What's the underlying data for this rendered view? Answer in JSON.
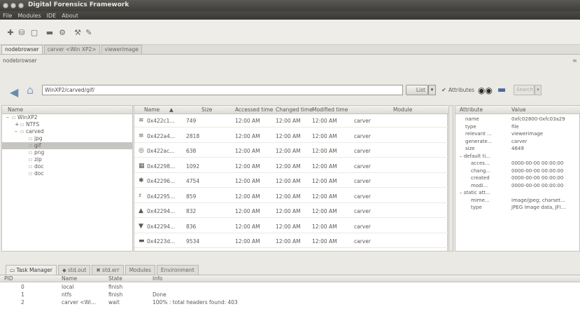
{
  "window": {
    "title": "Digital Forensics Framework"
  },
  "menu": [
    "File",
    "Modules",
    "IDE",
    "About"
  ],
  "tabs": [
    "nodebrowser",
    "carver <Win XP2>",
    "viewerimage"
  ],
  "pane_title": "nodebrowser",
  "pane_close": "≡",
  "path": "WinXP2/carved/gif/",
  "view_button": "List",
  "attributes_label": "Attributes",
  "search_button": "Search",
  "tree": {
    "header": "Name",
    "items": [
      {
        "label": "WinXP2",
        "level": 0,
        "expander": "–"
      },
      {
        "label": "NTFS",
        "level": 1,
        "expander": "+"
      },
      {
        "label": "carved",
        "level": 1,
        "expander": "–"
      },
      {
        "label": "jpg",
        "level": 2,
        "expander": ""
      },
      {
        "label": "gif",
        "level": 2,
        "expander": ""
      },
      {
        "label": "png",
        "level": 2,
        "expander": ""
      },
      {
        "label": "zip",
        "level": 2,
        "expander": ""
      },
      {
        "label": "doc",
        "level": 2,
        "expander": ""
      },
      {
        "label": "doc",
        "level": 2,
        "expander": ""
      }
    ],
    "selected": 4
  },
  "grid": {
    "headers": [
      "Name",
      "Size",
      "Accessed time",
      "Changed time",
      "Modified time",
      "Module"
    ],
    "rows": [
      {
        "icon": "≋",
        "name": "0x422c1...",
        "size": "749",
        "accessed": "12:00 AM",
        "changed": "12:00 AM",
        "modified": "12:00 AM",
        "module": "carver"
      },
      {
        "icon": "≡",
        "name": "0x422a4...",
        "size": "2818",
        "accessed": "12:00 AM",
        "changed": "12:00 AM",
        "modified": "12:00 AM",
        "module": "carver"
      },
      {
        "icon": "◎",
        "name": "0x422ac...",
        "size": "638",
        "accessed": "12:00 AM",
        "changed": "12:00 AM",
        "modified": "12:00 AM",
        "module": "carver"
      },
      {
        "icon": "▦",
        "name": "0x42298...",
        "size": "1092",
        "accessed": "12:00 AM",
        "changed": "12:00 AM",
        "modified": "12:00 AM",
        "module": "carver"
      },
      {
        "icon": "✱",
        "name": "0x42296...",
        "size": "4754",
        "accessed": "12:00 AM",
        "changed": "12:00 AM",
        "modified": "12:00 AM",
        "module": "carver"
      },
      {
        "icon": "♯",
        "name": "0x42295...",
        "size": "859",
        "accessed": "12:00 AM",
        "changed": "12:00 AM",
        "modified": "12:00 AM",
        "module": "carver"
      },
      {
        "icon": "▲",
        "name": "0x42294...",
        "size": "832",
        "accessed": "12:00 AM",
        "changed": "12:00 AM",
        "modified": "12:00 AM",
        "module": "carver"
      },
      {
        "icon": "▼",
        "name": "0x42294...",
        "size": "836",
        "accessed": "12:00 AM",
        "changed": "12:00 AM",
        "modified": "12:00 AM",
        "module": "carver"
      },
      {
        "icon": "▬",
        "name": "0x4223d...",
        "size": "9534",
        "accessed": "12:00 AM",
        "changed": "12:00 AM",
        "modified": "12:00 AM",
        "module": "carver"
      }
    ]
  },
  "attributes": {
    "headers": [
      "Attribute",
      "Value"
    ],
    "rows": [
      {
        "attr": "name",
        "value": "0xfc02800-0xfc03a29",
        "indent": 1
      },
      {
        "attr": "type",
        "value": "file",
        "indent": 1
      },
      {
        "attr": "relevant ...",
        "value": "viewerimage",
        "indent": 1
      },
      {
        "attr": "generate...",
        "value": "carver",
        "indent": 1
      },
      {
        "attr": "size",
        "value": "4649",
        "indent": 1
      },
      {
        "attr": "– default ti...",
        "value": "",
        "indent": 0
      },
      {
        "attr": "acces...",
        "value": "0000-00-00 00:00:00",
        "indent": 2
      },
      {
        "attr": "chang...",
        "value": "0000-00-00 00:00:00",
        "indent": 2
      },
      {
        "attr": "created",
        "value": "0000-00-00 00:00:00",
        "indent": 2
      },
      {
        "attr": "modi...",
        "value": "0000-00-00 00:00:00",
        "indent": 2
      },
      {
        "attr": "– static att...",
        "value": "",
        "indent": 0
      },
      {
        "attr": "mime...",
        "value": "image/jpeg; charset...",
        "indent": 2
      },
      {
        "attr": "type",
        "value": "JPEG image data, JFI...",
        "indent": 2
      }
    ]
  },
  "task_tabs": [
    "Task Manager",
    "std.out",
    "std.err",
    "Modules",
    "Environment"
  ],
  "tasks": {
    "headers": [
      "PID",
      "Name",
      "State",
      "Info"
    ],
    "rows": [
      {
        "pid": "0",
        "name": "local",
        "state": "finish",
        "info": ""
      },
      {
        "pid": "1",
        "name": "ntfs",
        "state": "finish",
        "info": "Done"
      },
      {
        "pid": "2",
        "name": "carver <Wi...",
        "state": "wait",
        "info": "100% : total headers found: 403"
      }
    ]
  }
}
